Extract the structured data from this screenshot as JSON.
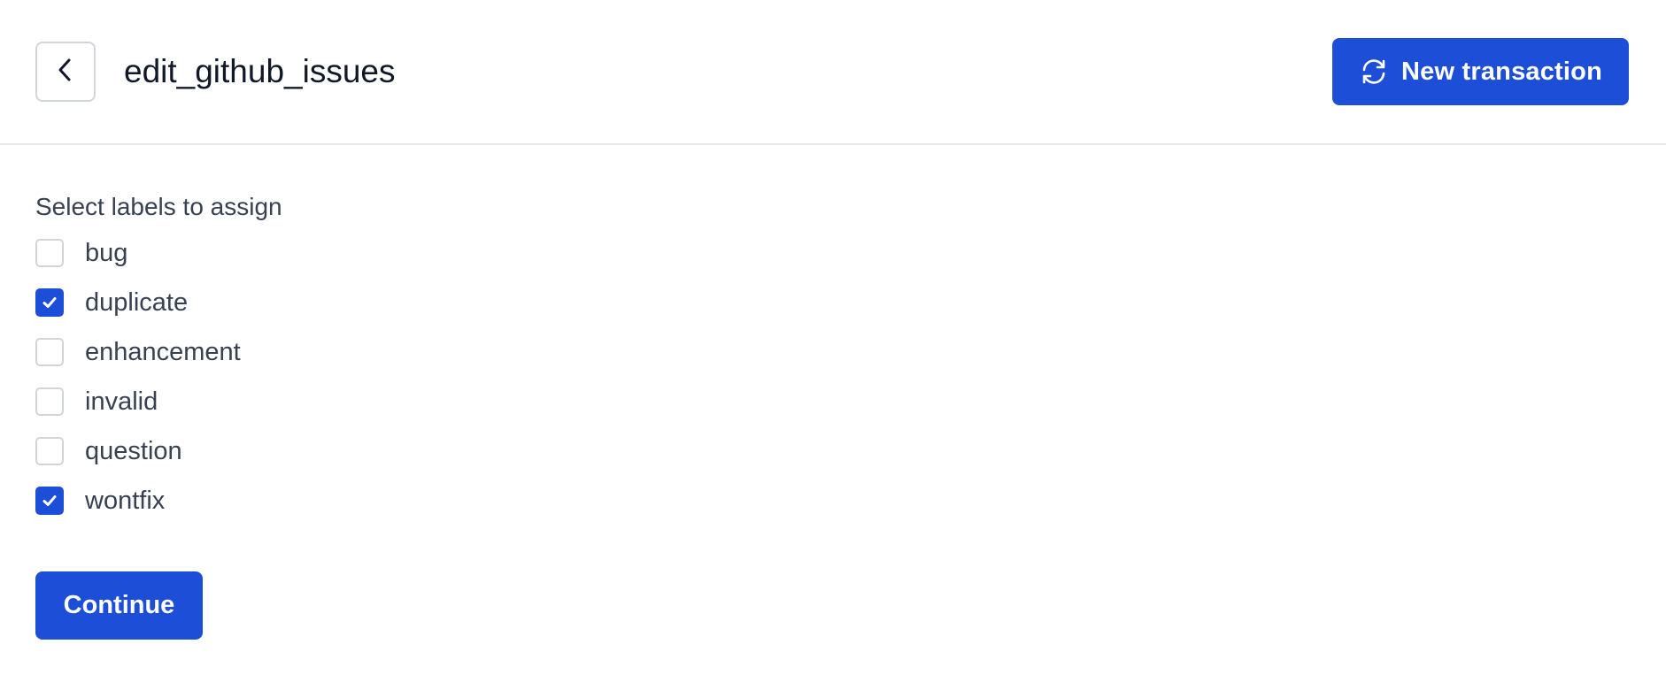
{
  "header": {
    "back_icon": "chevron-left-icon",
    "title": "edit_github_issues",
    "new_transaction": {
      "icon": "refresh-icon",
      "label": "New transaction"
    }
  },
  "form": {
    "label": "Select labels to assign",
    "options": [
      {
        "label": "bug",
        "checked": false
      },
      {
        "label": "duplicate",
        "checked": true
      },
      {
        "label": "enhancement",
        "checked": false
      },
      {
        "label": "invalid",
        "checked": false
      },
      {
        "label": "question",
        "checked": false
      },
      {
        "label": "wontfix",
        "checked": true
      }
    ],
    "continue_label": "Continue"
  },
  "colors": {
    "accent": "#1d4ed8",
    "border": "#d1d5db",
    "text": "#374151",
    "title": "#111827"
  }
}
